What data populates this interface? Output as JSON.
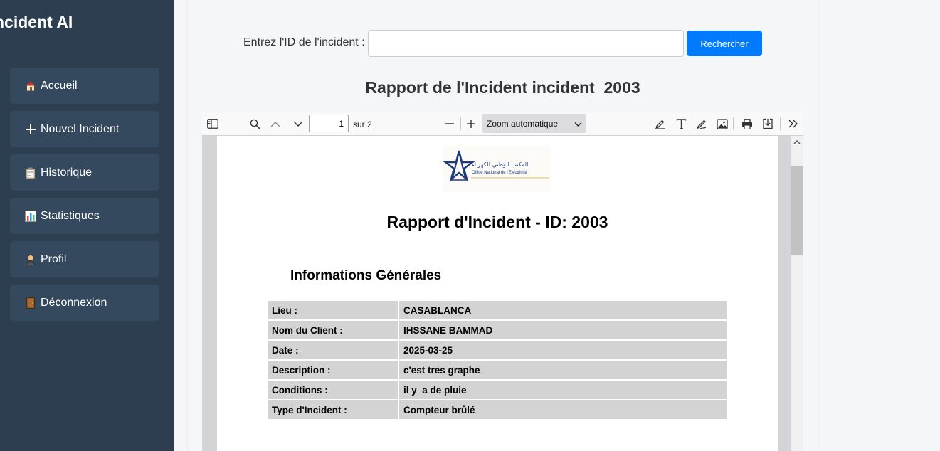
{
  "app": {
    "brand": "ncident AI"
  },
  "sidebar": {
    "items": [
      {
        "label": "Accueil",
        "icon": "house-icon"
      },
      {
        "label": "Nouvel Incident",
        "icon": "plus-icon"
      },
      {
        "label": "Historique",
        "icon": "clipboard-icon"
      },
      {
        "label": "Statistiques",
        "icon": "bar-chart-icon"
      },
      {
        "label": "Profil",
        "icon": "user-icon"
      },
      {
        "label": "Déconnexion",
        "icon": "door-icon"
      }
    ]
  },
  "search": {
    "label": "Entrez l'ID de l'incident :",
    "value": "",
    "button_label": "Rechercher"
  },
  "report": {
    "title": "Rapport de l'Incident incident_2003"
  },
  "pdf_viewer": {
    "current_page": "1",
    "total_pages_label": "sur 2",
    "zoom_label": "Zoom automatique"
  },
  "document": {
    "logo_text_ar": "المكتب الوطني للكهرباء",
    "logo_text_fr": "Office National de l'Electricité",
    "title": "Rapport d'Incident - ID: 2003",
    "section_title": "Informations Générales",
    "rows": [
      {
        "key": "Lieu :",
        "value": "CASABLANCA"
      },
      {
        "key": "Nom du Client :",
        "value": "IHSSANE BAMMAD"
      },
      {
        "key": "Date :",
        "value": "2025-03-25"
      },
      {
        "key": "Description :",
        "value": "c'est tres graphe"
      },
      {
        "key": "Conditions :",
        "value": "il y  a de pluie"
      },
      {
        "key": "Type d'Incident :",
        "value": "Compteur brûlé"
      }
    ]
  },
  "colors": {
    "sidebar_bg": "#2c3e50",
    "nav_item_bg": "#34495e",
    "primary_button": "#007bff",
    "table_cell_bg": "#d3d3d3"
  }
}
